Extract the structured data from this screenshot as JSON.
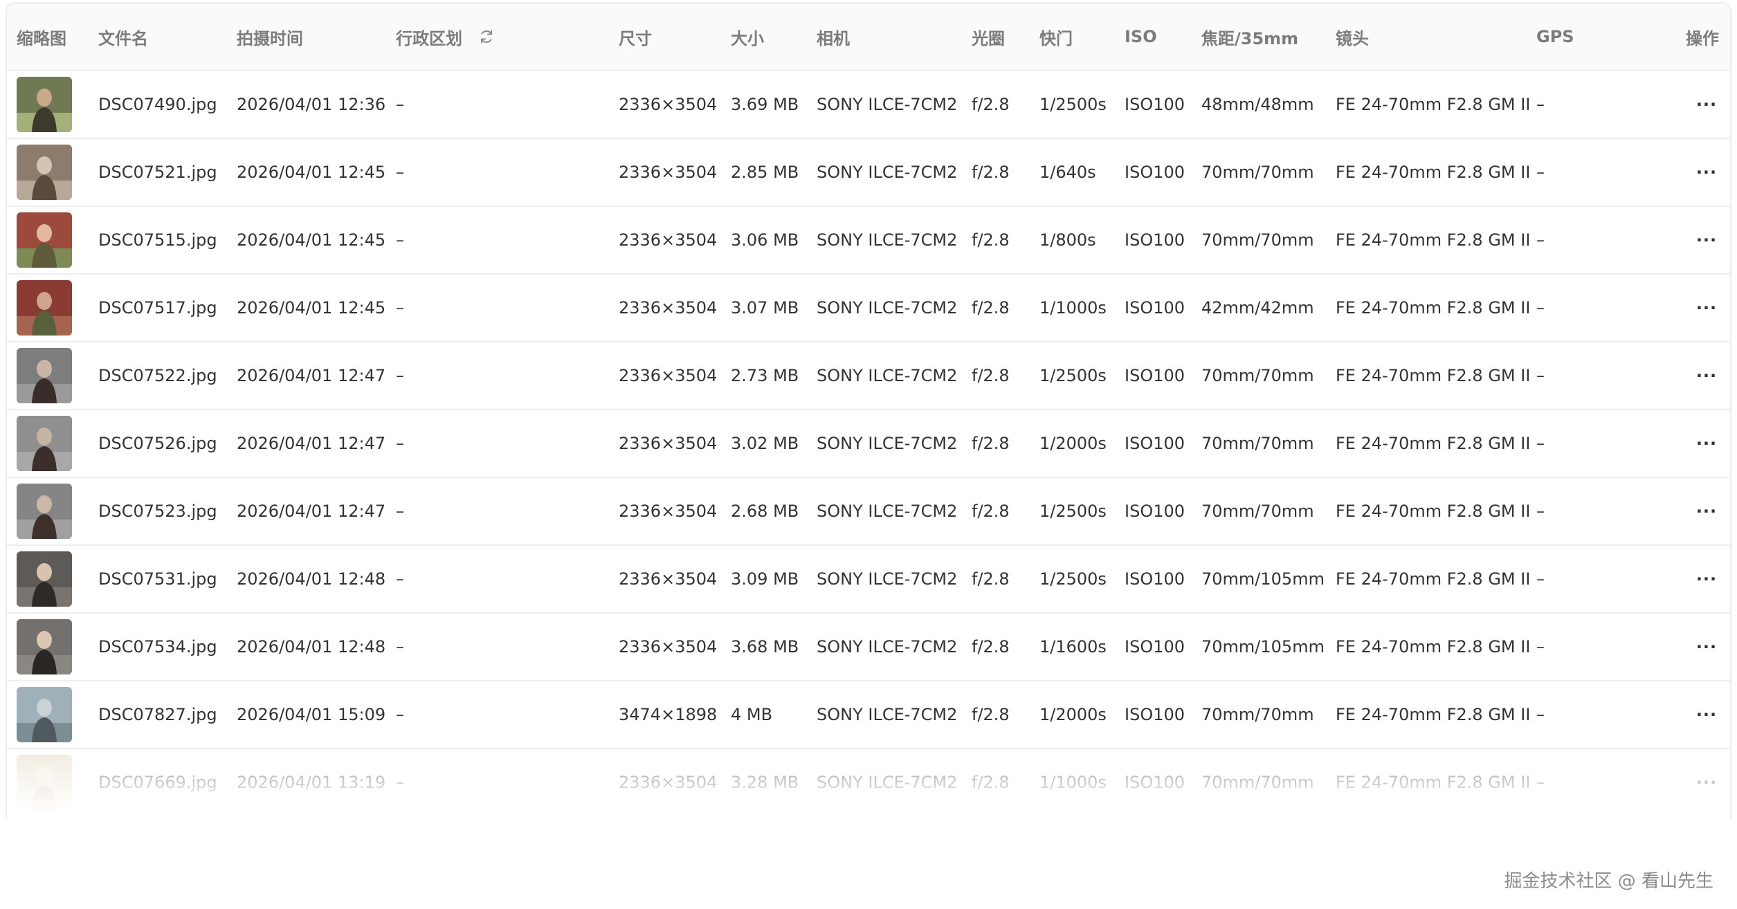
{
  "columns": {
    "thumb": "缩略图",
    "filename": "文件名",
    "time": "拍摄时间",
    "region": "行政区划",
    "dims": "尺寸",
    "size": "大小",
    "camera": "相机",
    "aperture": "光圈",
    "shutter": "快门",
    "iso": "ISO",
    "focal": "焦距/35mm",
    "lens": "镜头",
    "gps": "GPS",
    "actions": "操作"
  },
  "rows": [
    {
      "filename": "DSC07490.jpg",
      "time": "2026/04/01 12:36",
      "region": "–",
      "dims": "2336×3504",
      "size": "3.69 MB",
      "camera": "SONY ILCE-7CM2",
      "aperture": "f/2.8",
      "shutter": "1/2500s",
      "iso": "ISO100",
      "focal": "48mm/48mm",
      "lens": "FE 24-70mm F2.8 GM II",
      "gps": "–",
      "more": "···"
    },
    {
      "filename": "DSC07521.jpg",
      "time": "2026/04/01 12:45",
      "region": "–",
      "dims": "2336×3504",
      "size": "2.85 MB",
      "camera": "SONY ILCE-7CM2",
      "aperture": "f/2.8",
      "shutter": "1/640s",
      "iso": "ISO100",
      "focal": "70mm/70mm",
      "lens": "FE 24-70mm F2.8 GM II",
      "gps": "–",
      "more": "···"
    },
    {
      "filename": "DSC07515.jpg",
      "time": "2026/04/01 12:45",
      "region": "–",
      "dims": "2336×3504",
      "size": "3.06 MB",
      "camera": "SONY ILCE-7CM2",
      "aperture": "f/2.8",
      "shutter": "1/800s",
      "iso": "ISO100",
      "focal": "70mm/70mm",
      "lens": "FE 24-70mm F2.8 GM II",
      "gps": "–",
      "more": "···"
    },
    {
      "filename": "DSC07517.jpg",
      "time": "2026/04/01 12:45",
      "region": "–",
      "dims": "2336×3504",
      "size": "3.07 MB",
      "camera": "SONY ILCE-7CM2",
      "aperture": "f/2.8",
      "shutter": "1/1000s",
      "iso": "ISO100",
      "focal": "42mm/42mm",
      "lens": "FE 24-70mm F2.8 GM II",
      "gps": "–",
      "more": "···"
    },
    {
      "filename": "DSC07522.jpg",
      "time": "2026/04/01 12:47",
      "region": "–",
      "dims": "2336×3504",
      "size": "2.73 MB",
      "camera": "SONY ILCE-7CM2",
      "aperture": "f/2.8",
      "shutter": "1/2500s",
      "iso": "ISO100",
      "focal": "70mm/70mm",
      "lens": "FE 24-70mm F2.8 GM II",
      "gps": "–",
      "more": "···"
    },
    {
      "filename": "DSC07526.jpg",
      "time": "2026/04/01 12:47",
      "region": "–",
      "dims": "2336×3504",
      "size": "3.02 MB",
      "camera": "SONY ILCE-7CM2",
      "aperture": "f/2.8",
      "shutter": "1/2000s",
      "iso": "ISO100",
      "focal": "70mm/70mm",
      "lens": "FE 24-70mm F2.8 GM II",
      "gps": "–",
      "more": "···"
    },
    {
      "filename": "DSC07523.jpg",
      "time": "2026/04/01 12:47",
      "region": "–",
      "dims": "2336×3504",
      "size": "2.68 MB",
      "camera": "SONY ILCE-7CM2",
      "aperture": "f/2.8",
      "shutter": "1/2500s",
      "iso": "ISO100",
      "focal": "70mm/70mm",
      "lens": "FE 24-70mm F2.8 GM II",
      "gps": "–",
      "more": "···"
    },
    {
      "filename": "DSC07531.jpg",
      "time": "2026/04/01 12:48",
      "region": "–",
      "dims": "2336×3504",
      "size": "3.09 MB",
      "camera": "SONY ILCE-7CM2",
      "aperture": "f/2.8",
      "shutter": "1/2500s",
      "iso": "ISO100",
      "focal": "70mm/105mm",
      "lens": "FE 24-70mm F2.8 GM II",
      "gps": "–",
      "more": "···"
    },
    {
      "filename": "DSC07534.jpg",
      "time": "2026/04/01 12:48",
      "region": "–",
      "dims": "2336×3504",
      "size": "3.68 MB",
      "camera": "SONY ILCE-7CM2",
      "aperture": "f/2.8",
      "shutter": "1/1600s",
      "iso": "ISO100",
      "focal": "70mm/105mm",
      "lens": "FE 24-70mm F2.8 GM II",
      "gps": "–",
      "more": "···"
    },
    {
      "filename": "DSC07827.jpg",
      "time": "2026/04/01 15:09",
      "region": "–",
      "dims": "3474×1898",
      "size": "4 MB",
      "camera": "SONY ILCE-7CM2",
      "aperture": "f/2.8",
      "shutter": "1/2000s",
      "iso": "ISO100",
      "focal": "70mm/70mm",
      "lens": "FE 24-70mm F2.8 GM II",
      "gps": "–",
      "more": "···"
    },
    {
      "filename": "DSC07669.jpg",
      "time": "2026/04/01 13:19",
      "region": "–",
      "dims": "2336×3504",
      "size": "3.28 MB",
      "camera": "SONY ILCE-7CM2",
      "aperture": "f/2.8",
      "shutter": "1/1000s",
      "iso": "ISO100",
      "focal": "70mm/70mm",
      "lens": "FE 24-70mm F2.8 GM II",
      "gps": "–",
      "more": "···"
    }
  ],
  "icons": {
    "refresh": "refresh-icon",
    "more": "more-horizontal-icon"
  },
  "colors": {
    "header_bg": "#fafafa",
    "header_text": "#7c7c7c",
    "row_text": "#333333",
    "border": "#eeeeee"
  },
  "watermark": "掘金技术社区 @ 看山先生"
}
